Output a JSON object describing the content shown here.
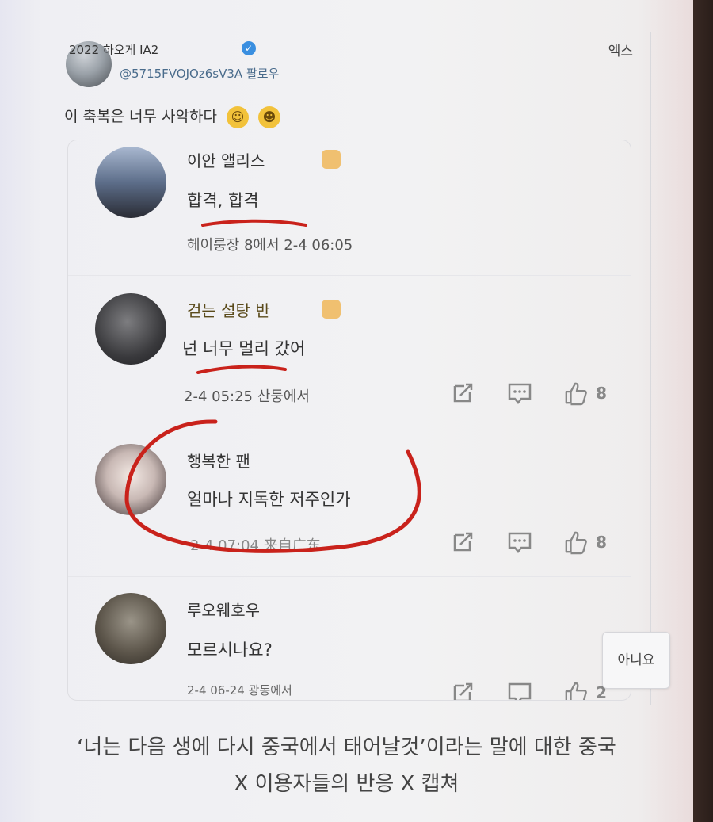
{
  "post": {
    "author": "2022 하오게 IA2",
    "handle": "@5715FVOJOz6sV3A 팔로우",
    "platform": "엑스",
    "text": "이 축복은 너무 사악하다"
  },
  "comments": [
    {
      "name": "이안 앨리스",
      "text": "합격, 합격",
      "meta": "헤이룽장 8에서 2-4 06:05"
    },
    {
      "name": "걷는 설탕 반",
      "text": "넌 너무 멀리 갔어",
      "meta": "2-4 05:25 산둥에서",
      "likes": "8"
    },
    {
      "name": "행복한 팬",
      "text": "얼마나 지독한 저주인가",
      "meta": "2-4 07:04 来自广东",
      "likes": "8"
    },
    {
      "name": "루오웨호우",
      "text": "모르시나요?",
      "meta": "2-4 06-24 광동에서",
      "likes": "2"
    }
  ],
  "tooltip": "아니요",
  "caption": {
    "line1": "‘너는 다음 생에 다시 중국에서 태어날것’이라는 말에 대한 중국",
    "line2": "X 이용자들의 반응 X 캡쳐"
  }
}
